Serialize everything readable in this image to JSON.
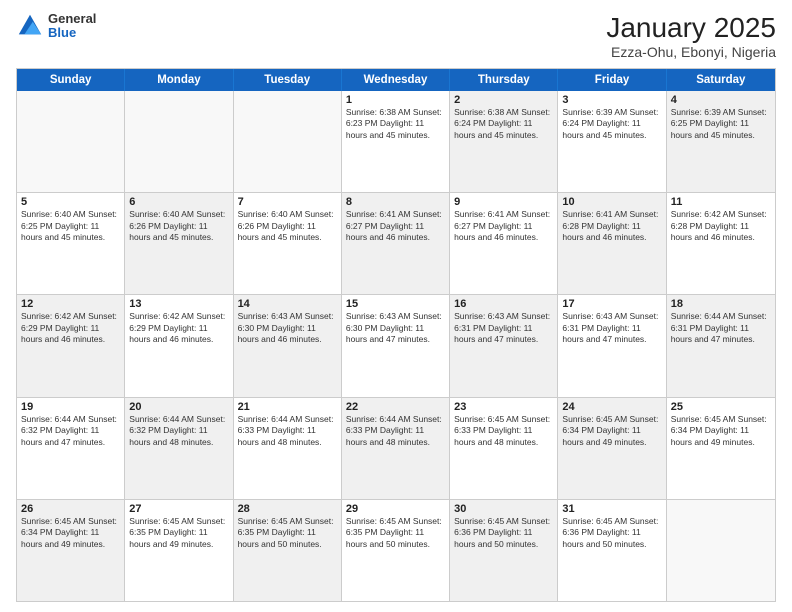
{
  "header": {
    "logo": {
      "line1": "General",
      "line2": "Blue"
    },
    "title": "January 2025",
    "subtitle": "Ezza-Ohu, Ebonyi, Nigeria"
  },
  "days_of_week": [
    "Sunday",
    "Monday",
    "Tuesday",
    "Wednesday",
    "Thursday",
    "Friday",
    "Saturday"
  ],
  "weeks": [
    [
      {
        "day": "",
        "info": "",
        "shaded": false,
        "empty": true
      },
      {
        "day": "",
        "info": "",
        "shaded": false,
        "empty": true
      },
      {
        "day": "",
        "info": "",
        "shaded": false,
        "empty": true
      },
      {
        "day": "1",
        "info": "Sunrise: 6:38 AM\nSunset: 6:23 PM\nDaylight: 11 hours\nand 45 minutes.",
        "shaded": false
      },
      {
        "day": "2",
        "info": "Sunrise: 6:38 AM\nSunset: 6:24 PM\nDaylight: 11 hours\nand 45 minutes.",
        "shaded": true
      },
      {
        "day": "3",
        "info": "Sunrise: 6:39 AM\nSunset: 6:24 PM\nDaylight: 11 hours\nand 45 minutes.",
        "shaded": false
      },
      {
        "day": "4",
        "info": "Sunrise: 6:39 AM\nSunset: 6:25 PM\nDaylight: 11 hours\nand 45 minutes.",
        "shaded": true
      }
    ],
    [
      {
        "day": "5",
        "info": "Sunrise: 6:40 AM\nSunset: 6:25 PM\nDaylight: 11 hours\nand 45 minutes.",
        "shaded": false
      },
      {
        "day": "6",
        "info": "Sunrise: 6:40 AM\nSunset: 6:26 PM\nDaylight: 11 hours\nand 45 minutes.",
        "shaded": true
      },
      {
        "day": "7",
        "info": "Sunrise: 6:40 AM\nSunset: 6:26 PM\nDaylight: 11 hours\nand 45 minutes.",
        "shaded": false
      },
      {
        "day": "8",
        "info": "Sunrise: 6:41 AM\nSunset: 6:27 PM\nDaylight: 11 hours\nand 46 minutes.",
        "shaded": true
      },
      {
        "day": "9",
        "info": "Sunrise: 6:41 AM\nSunset: 6:27 PM\nDaylight: 11 hours\nand 46 minutes.",
        "shaded": false
      },
      {
        "day": "10",
        "info": "Sunrise: 6:41 AM\nSunset: 6:28 PM\nDaylight: 11 hours\nand 46 minutes.",
        "shaded": true
      },
      {
        "day": "11",
        "info": "Sunrise: 6:42 AM\nSunset: 6:28 PM\nDaylight: 11 hours\nand 46 minutes.",
        "shaded": false
      }
    ],
    [
      {
        "day": "12",
        "info": "Sunrise: 6:42 AM\nSunset: 6:29 PM\nDaylight: 11 hours\nand 46 minutes.",
        "shaded": true
      },
      {
        "day": "13",
        "info": "Sunrise: 6:42 AM\nSunset: 6:29 PM\nDaylight: 11 hours\nand 46 minutes.",
        "shaded": false
      },
      {
        "day": "14",
        "info": "Sunrise: 6:43 AM\nSunset: 6:30 PM\nDaylight: 11 hours\nand 46 minutes.",
        "shaded": true
      },
      {
        "day": "15",
        "info": "Sunrise: 6:43 AM\nSunset: 6:30 PM\nDaylight: 11 hours\nand 47 minutes.",
        "shaded": false
      },
      {
        "day": "16",
        "info": "Sunrise: 6:43 AM\nSunset: 6:31 PM\nDaylight: 11 hours\nand 47 minutes.",
        "shaded": true
      },
      {
        "day": "17",
        "info": "Sunrise: 6:43 AM\nSunset: 6:31 PM\nDaylight: 11 hours\nand 47 minutes.",
        "shaded": false
      },
      {
        "day": "18",
        "info": "Sunrise: 6:44 AM\nSunset: 6:31 PM\nDaylight: 11 hours\nand 47 minutes.",
        "shaded": true
      }
    ],
    [
      {
        "day": "19",
        "info": "Sunrise: 6:44 AM\nSunset: 6:32 PM\nDaylight: 11 hours\nand 47 minutes.",
        "shaded": false
      },
      {
        "day": "20",
        "info": "Sunrise: 6:44 AM\nSunset: 6:32 PM\nDaylight: 11 hours\nand 48 minutes.",
        "shaded": true
      },
      {
        "day": "21",
        "info": "Sunrise: 6:44 AM\nSunset: 6:33 PM\nDaylight: 11 hours\nand 48 minutes.",
        "shaded": false
      },
      {
        "day": "22",
        "info": "Sunrise: 6:44 AM\nSunset: 6:33 PM\nDaylight: 11 hours\nand 48 minutes.",
        "shaded": true
      },
      {
        "day": "23",
        "info": "Sunrise: 6:45 AM\nSunset: 6:33 PM\nDaylight: 11 hours\nand 48 minutes.",
        "shaded": false
      },
      {
        "day": "24",
        "info": "Sunrise: 6:45 AM\nSunset: 6:34 PM\nDaylight: 11 hours\nand 49 minutes.",
        "shaded": true
      },
      {
        "day": "25",
        "info": "Sunrise: 6:45 AM\nSunset: 6:34 PM\nDaylight: 11 hours\nand 49 minutes.",
        "shaded": false
      }
    ],
    [
      {
        "day": "26",
        "info": "Sunrise: 6:45 AM\nSunset: 6:34 PM\nDaylight: 11 hours\nand 49 minutes.",
        "shaded": true
      },
      {
        "day": "27",
        "info": "Sunrise: 6:45 AM\nSunset: 6:35 PM\nDaylight: 11 hours\nand 49 minutes.",
        "shaded": false
      },
      {
        "day": "28",
        "info": "Sunrise: 6:45 AM\nSunset: 6:35 PM\nDaylight: 11 hours\nand 50 minutes.",
        "shaded": true
      },
      {
        "day": "29",
        "info": "Sunrise: 6:45 AM\nSunset: 6:35 PM\nDaylight: 11 hours\nand 50 minutes.",
        "shaded": false
      },
      {
        "day": "30",
        "info": "Sunrise: 6:45 AM\nSunset: 6:36 PM\nDaylight: 11 hours\nand 50 minutes.",
        "shaded": true
      },
      {
        "day": "31",
        "info": "Sunrise: 6:45 AM\nSunset: 6:36 PM\nDaylight: 11 hours\nand 50 minutes.",
        "shaded": false
      },
      {
        "day": "",
        "info": "",
        "shaded": false,
        "empty": true
      }
    ]
  ]
}
